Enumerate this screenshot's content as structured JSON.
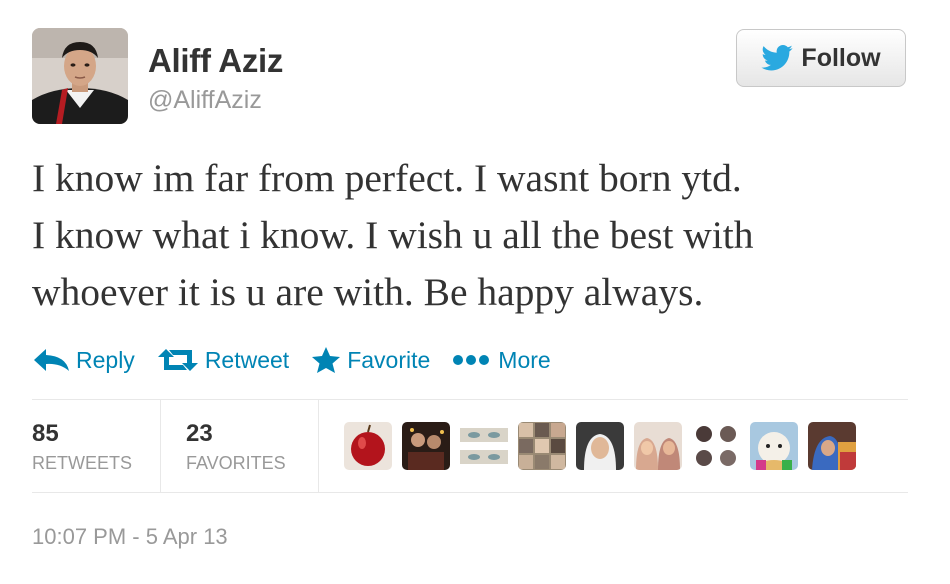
{
  "author": {
    "name": "Aliff Aziz",
    "handle": "@AliffAziz"
  },
  "follow_button": {
    "label": "Follow",
    "icon": "twitter-bird-icon"
  },
  "tweet": {
    "lines": [
      "I know im far from perfect. I wasnt born ytd.",
      "I know what i know. I wish u all the best with",
      "whoever it is u are with. Be happy always."
    ]
  },
  "actions": [
    {
      "label": "Reply",
      "icon": "reply-icon"
    },
    {
      "label": "Retweet",
      "icon": "retweet-icon"
    },
    {
      "label": "Favorite",
      "icon": "star-icon"
    },
    {
      "label": "More",
      "icon": "more-dots-icon"
    }
  ],
  "stats": {
    "retweets": {
      "count": "85",
      "label": "RETWEETS"
    },
    "favorites": {
      "count": "23",
      "label": "FAVORITES"
    }
  },
  "favoriters": [
    {
      "name": "favoriter-1",
      "color": "#b3141c"
    },
    {
      "name": "favoriter-2",
      "color": "#3a2a22"
    },
    {
      "name": "favoriter-3",
      "color": "#d9d4c8"
    },
    {
      "name": "favoriter-4",
      "color": "#9a8a74"
    },
    {
      "name": "favoriter-5",
      "color": "#4a4a4a"
    },
    {
      "name": "favoriter-6",
      "color": "#c98f7a"
    },
    {
      "name": "favoriter-7",
      "color": "#6b5a55"
    },
    {
      "name": "favoriter-8",
      "color": "#e6b96a"
    },
    {
      "name": "favoriter-9",
      "color": "#7a5a50"
    }
  ],
  "timestamp": "10:07 PM - 5 Apr 13",
  "colors": {
    "link": "#0084b4",
    "muted": "#999999",
    "text": "#333333",
    "twitter_blue": "#2aa9e0"
  }
}
